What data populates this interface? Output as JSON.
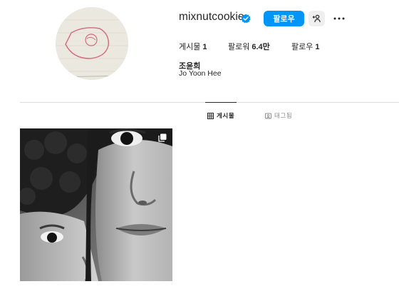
{
  "profile": {
    "username": "mixnutcookie",
    "verified": true,
    "full_name": "조윤희",
    "bio": "Jo Yoon Hee",
    "avatar_icon": "doodle-avatar"
  },
  "actions": {
    "follow_label": "팔로우",
    "suggest_icon": "person-plus-icon",
    "more_icon": "more-icon"
  },
  "stats": {
    "posts_label": "게시물",
    "posts_value": "1",
    "followers_label": "팔로워",
    "followers_value": "6.4만",
    "following_label": "팔로우",
    "following_value": "1"
  },
  "tabs": [
    {
      "label": "게시물",
      "icon": "grid-icon",
      "active": true
    },
    {
      "label": "태그됨",
      "icon": "tag-icon",
      "active": false
    }
  ],
  "posts": [
    {
      "icon": "multi-photo-icon",
      "description": ""
    }
  ],
  "colors": {
    "accent": "#0095f6",
    "verified": "#0095f6",
    "text": "#262626",
    "muted": "#8e8e8e"
  }
}
